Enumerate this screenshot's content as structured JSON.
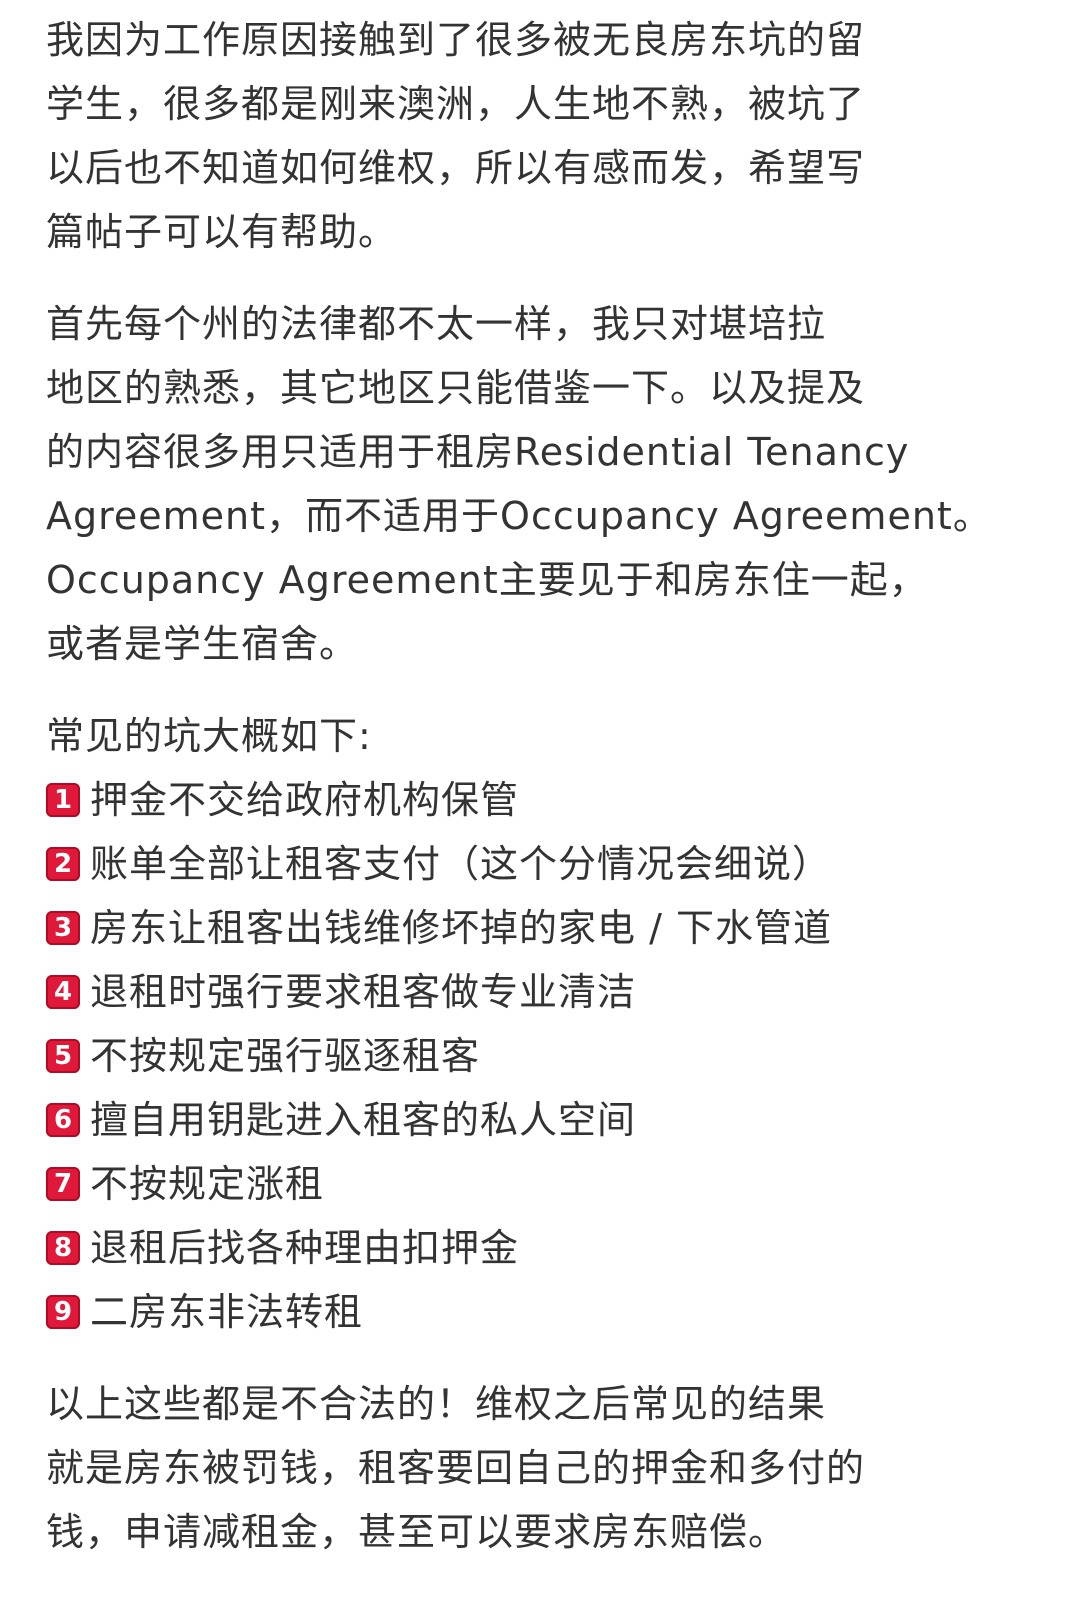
{
  "paragraphs": [
    {
      "lines": [
        "我因为工作原因接触到了很多被无良房东坑的留",
        "学生，很多都是刚来澳洲，人生地不熟，被坑了",
        "以后也不知道如何维权，所以有感而发，希望写",
        "篇帖子可以有帮助。"
      ]
    },
    {
      "lines": [
        "首先每个州的法律都不太一样，我只对堪培拉",
        "地区的熟悉，其它地区只能借鉴一下。以及提及",
        "的内容很多用只适用于租房Residential Tenancy",
        "Agreement，而不适用于Occupancy Agreement。",
        "Occupancy Agreement主要见于和房东住一起，",
        "或者是学生宿舍。"
      ]
    }
  ],
  "list": {
    "heading": "常见的坑大概如下:",
    "badge_color": "#e0193a",
    "items": [
      {
        "num": "1",
        "text": "押金不交给政府机构保管"
      },
      {
        "num": "2",
        "text": "账单全部让租客支付（这个分情况会细说）"
      },
      {
        "num": "3",
        "text": "房东让租客出钱维修坏掉的家电 / 下水管道"
      },
      {
        "num": "4",
        "text": "退租时强行要求租客做专业清洁"
      },
      {
        "num": "5",
        "text": "不按规定强行驱逐租客"
      },
      {
        "num": "6",
        "text": "擅自用钥匙进入租客的私人空间"
      },
      {
        "num": "7",
        "text": "不按规定涨租"
      },
      {
        "num": "8",
        "text": "退租后找各种理由扣押金"
      },
      {
        "num": "9",
        "text": "二房东非法转租"
      }
    ]
  },
  "closing": {
    "lines": [
      "以上这些都是不合法的！维权之后常见的结果",
      "就是房东被罚钱，租客要回自己的押金和多付的",
      "钱，申请减租金，甚至可以要求房东赔偿。"
    ]
  }
}
